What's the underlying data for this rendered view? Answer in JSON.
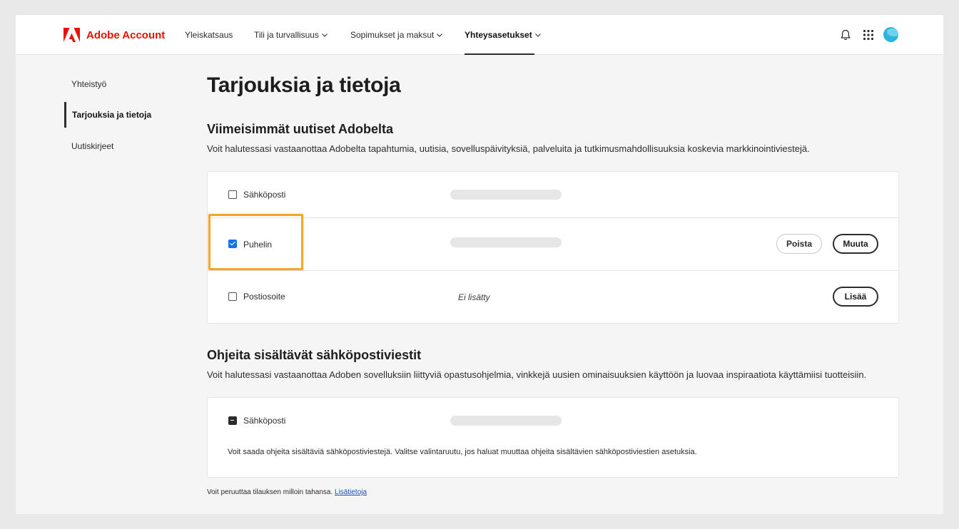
{
  "brand": {
    "name": "Adobe Account",
    "color": "#eb1000",
    "logo_icon": "adobe-logo-icon"
  },
  "nav": {
    "items": [
      {
        "label": "Yleiskatsaus",
        "has_dropdown": false,
        "active": false
      },
      {
        "label": "Tili ja turvallisuus",
        "has_dropdown": true,
        "active": false
      },
      {
        "label": "Sopimukset ja maksut",
        "has_dropdown": true,
        "active": false
      },
      {
        "label": "Yhteysasetukset",
        "has_dropdown": true,
        "active": true
      }
    ],
    "icons": [
      "bell-icon",
      "apps-grid-icon",
      "avatar"
    ]
  },
  "sidebar": {
    "items": [
      {
        "label": "Yhteistyö",
        "active": false
      },
      {
        "label": "Tarjouksia ja tietoja",
        "active": true
      },
      {
        "label": "Uutiskirjeet",
        "active": false
      }
    ]
  },
  "main": {
    "title": "Tarjouksia ja tietoja",
    "news": {
      "title": "Viimeisimmät uutiset Adobelta",
      "description": "Voit halutessasi vastaanottaa Adobelta tapahtumia, uutisia, sovelluspäivityksiä, palveluita ja tutkimusmahdollisuuksia koskevia markkinointiviestejä.",
      "rows": [
        {
          "label": "Sähköposti",
          "checked": false,
          "value_loading": true
        },
        {
          "label": "Puhelin",
          "checked": true,
          "value_loading": true,
          "buttons": [
            "Poista",
            "Muuta"
          ]
        },
        {
          "label": "Postiosoite",
          "checked": false,
          "value": "Ei lisätty",
          "buttons": [
            "Lisää"
          ]
        }
      ]
    },
    "tutorials": {
      "title": "Ohjeita sisältävät sähköpostiviestit",
      "description": "Voit halutessasi vastaanottaa Adoben sovelluksiin liittyviä opastusohjelmia, vinkkejä uusien ominaisuuksien käyttöön ja luovaa inspiraatiota käyttämiisi tuotteisiin.",
      "row": {
        "label": "Sähköposti",
        "state": "indeterminate",
        "value_loading": true
      },
      "note": "Voit saada ohjeita sisältäviä sähköpostiviestejä. Valitse valintaruutu, jos haluat muuttaa ohjeita sisältävien sähköpostiviestien asetuksia."
    },
    "footer": {
      "text": "Voit peruuttaa tilauksen milloin tahansa.",
      "link": "Lisätietoja"
    }
  },
  "colors": {
    "accent_blue": "#1473e6",
    "highlight_orange": "#f5a623",
    "link": "#1d4fb8"
  }
}
